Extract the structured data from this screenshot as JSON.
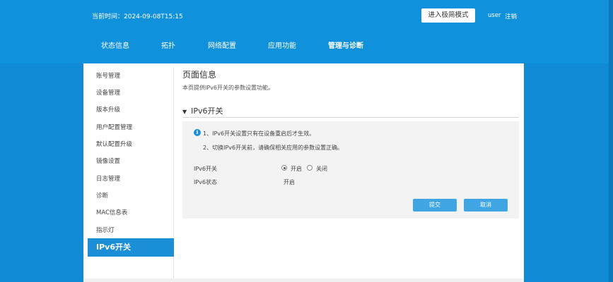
{
  "header": {
    "time_label": "当前时间：2024-09-08T15:15",
    "advanced_mode_label": "进入极简模式",
    "username": "user",
    "logout_label": "注销"
  },
  "nav": {
    "items": [
      "状态信息",
      "拓扑",
      "网络配置",
      "应用功能",
      "管理与诊断"
    ],
    "active": "管理与诊断"
  },
  "sidebar": {
    "items": [
      "账号管理",
      "设备管理",
      "版本升级",
      "用户配置管理",
      "默认配置升级",
      "镜像设置",
      "日志管理",
      "诊断",
      "MAC信息表",
      "指示灯",
      "IPv6开关"
    ],
    "active": "IPv6开关"
  },
  "page": {
    "title": "页面信息",
    "description": "本页提供IPv6开关的参数设置功能。"
  },
  "section": {
    "title": "IPv6开关",
    "notes": [
      "1、IPv6开关设置只有在设备重启后才生效。",
      "2、切换IPv6开关前，请确保相关应用的参数设置正确。"
    ],
    "switch_label": "IPv6开关",
    "option_on": "开启",
    "option_off": "关闭",
    "selected": "开启",
    "status_label": "IPv6状态",
    "status_value": "开启",
    "submit_label": "提交",
    "cancel_label": "取消"
  },
  "colors": {
    "header_bg": "#1091dc",
    "accent": "#1a8fd8",
    "button": "#3fa6e3"
  }
}
